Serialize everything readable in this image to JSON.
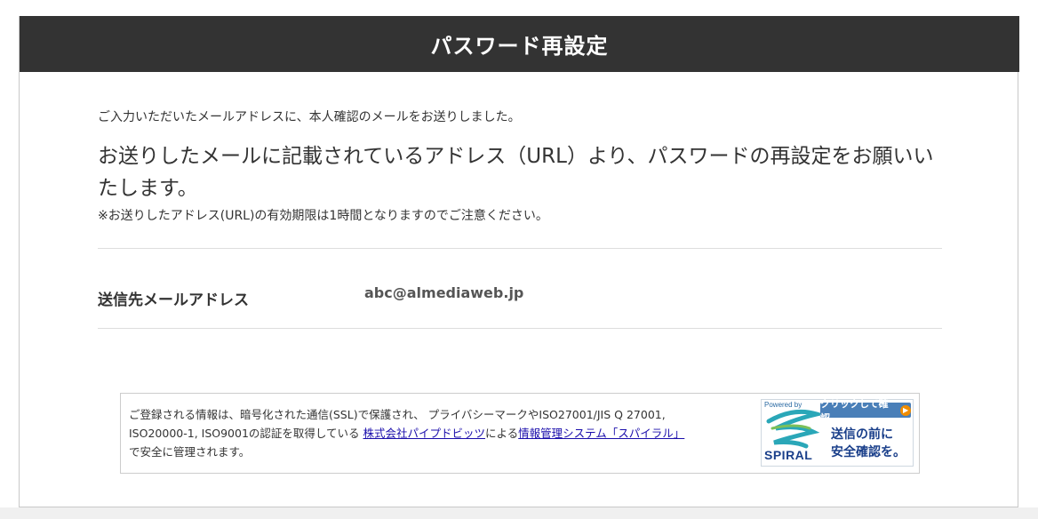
{
  "page": {
    "title": "パスワード再設定"
  },
  "message": {
    "lead": "ご入力いただいたメールアドレスに、本人確認のメールをお送りしました。",
    "main": "お送りしたメールに記載されているアドレス（URL）より、パスワードの再設定をお願いいたします。",
    "note": "※お送りしたアドレス(URL)の有効期限は1時間となりますのでご注意ください。"
  },
  "recipient": {
    "label": "送信先メールアドレス",
    "value": "abc@almediaweb.jp"
  },
  "security": {
    "line1": "ご登録される情報は、暗号化された通信(SSL)で保護され、 プライバシーマークやISO27001/JIS Q 27001,",
    "line2_prefix": "ISO20000-1, ISO9001の認証を取得している ",
    "company_link": "株式会社パイプドビッツ",
    "line2_mid": "による",
    "system_link": "情報管理システム「スパイラル」",
    "line3": "で安全に管理されます。"
  },
  "badge": {
    "powered": "Powered by",
    "brand": "SPIRAL",
    "click_label": "クリックして確認",
    "text1": "送信の前に",
    "text2": "安全確認を。",
    "brand_color": "#1a3f8a",
    "button_color": "#4a7fb8",
    "arrow_color": "#f08c00"
  }
}
